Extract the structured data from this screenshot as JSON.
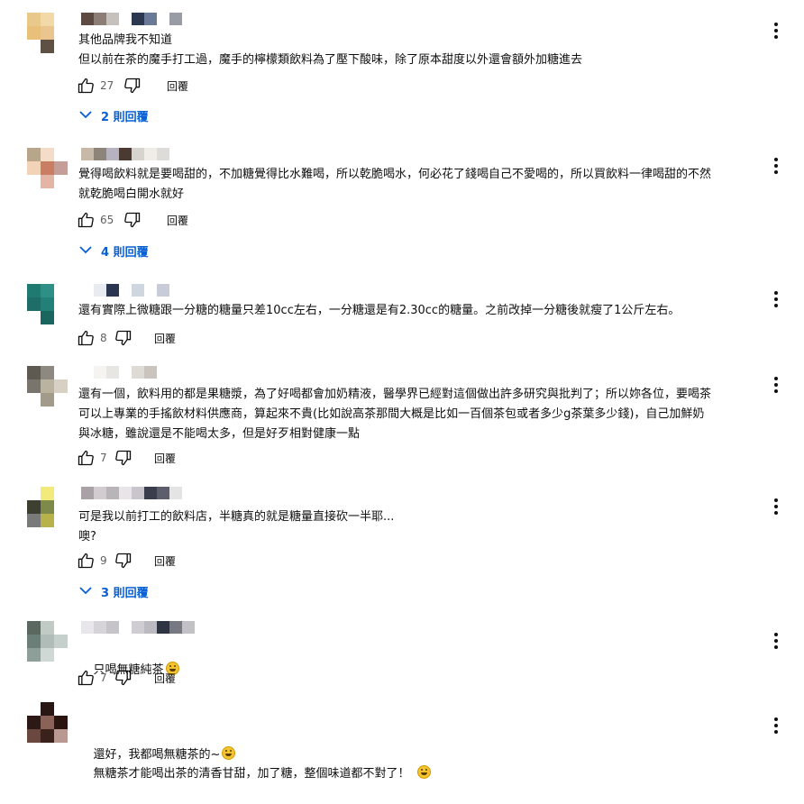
{
  "reply_label": "回覆",
  "comments": [
    {
      "id": 1,
      "text": "其他品牌我不知道\n但以前在茶的魔手打工過，魔手的檸檬類飲料為了壓下酸味，除了原本甜度以外還會額外加糖進去",
      "likes": "27",
      "replies": "2 則回覆",
      "avatar": [
        "#e8c98a",
        "#f2d9a7",
        "#ffffff",
        "#e9c07a",
        "#eac58f",
        "#ffffff",
        "#ffffff",
        "#5e5043",
        "#ffffff"
      ],
      "name": [
        "#5c4a42",
        "#8c7d77",
        "#c7c1bd",
        "#ffffff",
        "#2b3850",
        "#6a7a96",
        "#ffffff",
        "#9a9ca5"
      ]
    },
    {
      "id": 2,
      "text": "覺得喝飲料就是要喝甜的，不加糖覺得比水難喝，所以乾脆喝水，何必花了錢喝自己不愛喝的，所以買飲料一律喝甜的不然\n就乾脆喝白開水就好",
      "likes": "65",
      "replies": "4 則回覆",
      "avatar": [
        "#b8a68a",
        "#f4dcc8",
        "#ffffff",
        "#f2d3b8",
        "#c97e63",
        "#c69e98",
        "#ffffff",
        "#e4b4a4",
        "#ffffff"
      ],
      "name": [
        "#c8b8a8",
        "#8d857a",
        "#b7b2c0",
        "#4a3a32",
        "#d7d3cf",
        "#f0ece8",
        "#dedcd8"
      ]
    },
    {
      "id": 3,
      "text": "還有實際上微糖跟一分糖的糖量只差10cc左右，一分糖還是有2.30cc的糖量。之前改掉一分糖後就瘦了1公斤左右。",
      "likes": "8",
      "replies": null,
      "avatar": [
        "#1f7a72",
        "#2d8f86",
        "#ffffff",
        "#1e6d68",
        "#238078",
        "#ffffff",
        "#ffffff",
        "#1a6560",
        "#ffffff"
      ],
      "name": [
        "#ffffff",
        "#e8ebef",
        "#2a3550",
        "#ffffff",
        "#d0d6e0",
        "#ffffff",
        "#c8ccd8"
      ]
    },
    {
      "id": 4,
      "text": "還有一個，飲料用的都是果糖漿，為了好喝都會加奶精液，醫學界已經對這個做出許多研究與批判了；所以妳各位，要喝茶\n可以上專業的手搖飲材料供應商，算起來不貴(比如說高茶那間大概是比如一百個茶包或者多少g茶葉多少錢)，自己加鮮奶\n與冰糖，雖說還是不能喝太多，但是好歹相對健康一點",
      "likes": "7",
      "replies": null,
      "avatar": [
        "#5e5a52",
        "#8d8880",
        "#ffffff",
        "#7a756c",
        "#bab39f",
        "#d7d0c5",
        "#ffffff",
        "#a39b8a",
        "#ffffff"
      ],
      "name": [
        "#ffffff",
        "#f5f4f0",
        "#e8e6e2",
        "#ffffff",
        "#dedad6",
        "#c9c4be",
        "#ffffff"
      ]
    },
    {
      "id": 5,
      "text": "可是我以前打工的飲料店，半糖真的就是糖量直接砍一半耶...\n噢?",
      "likes": "9",
      "replies": "3 則回覆",
      "avatar": [
        "#ffffff",
        "#f2ea7a",
        "#ffffff",
        "#3d4030",
        "#7d8a4a",
        "#ffffff",
        "#7a7a7a",
        "#b8b24a",
        "#ffffff"
      ],
      "name": [
        "#a8a2a6",
        "#d2ccd0",
        "#b8b4b8",
        "#e8e4e8",
        "#c8c6cc",
        "#3a3d4c",
        "#5c5e6c",
        "#e4e4e4"
      ]
    },
    {
      "id": 6,
      "text": "只喝無糖純茶",
      "emoji": true,
      "likes": "7",
      "replies": null,
      "avatar": [
        "#5a6860",
        "#c2cac6",
        "#ffffff",
        "#6c7e78",
        "#b0bcb8",
        "#c5cfcc",
        "#8e9e98",
        "#d0d8d6",
        "#ffffff"
      ],
      "name": [
        "#e8e6ea",
        "#d6d4d8",
        "#c6c4c8",
        "#ffffff",
        "#cfcdd1",
        "#bcbac0",
        "#2e3442",
        "#767882",
        "#c2c2c6"
      ]
    },
    {
      "id": 7,
      "text": "還好，我都喝無糖茶的~",
      "text2": "無糖茶才能喝出茶的清香甘甜，加了糖，整個味道都不對了！",
      "emoji": true,
      "likes": null,
      "replies": null,
      "avatar": [
        "#ffffff",
        "#2a1612",
        "#ffffff",
        "#2c1814",
        "#8a6258",
        "#2a1410",
        "#6a4840",
        "#3a221c",
        "#b89890"
      ],
      "name": []
    }
  ]
}
